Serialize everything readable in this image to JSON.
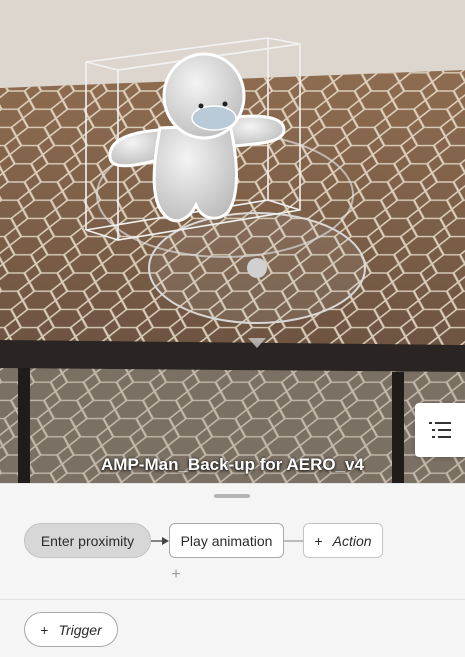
{
  "viewport": {
    "model_title": "AMP-Man_Back-up for AERO_v4",
    "menu_icon": "list-icon"
  },
  "behavior": {
    "trigger_label": "Enter proximity",
    "action_label": "Play animation",
    "add_action_label": "Action",
    "add_symbol": "+",
    "add_trigger_label": "Trigger"
  },
  "colors": {
    "sheet_background": "#f5f5f5",
    "trigger_chip": "#d7d7d7",
    "title_text": "#ffffff"
  }
}
